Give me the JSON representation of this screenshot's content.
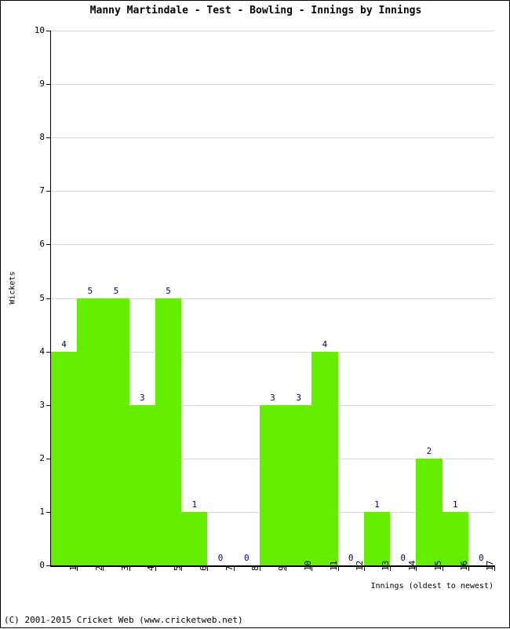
{
  "title": "Manny Martindale - Test - Bowling - Innings by Innings",
  "footer": "(C) 2001-2015 Cricket Web (www.cricketweb.net)",
  "colors": {
    "bar": "#66ee00",
    "label": "#000080",
    "axis": "#000000",
    "grid": "#d8d8d8",
    "background": "#ffffff"
  },
  "chart_data": {
    "type": "bar",
    "title": "Manny Martindale - Test - Bowling - Innings by Innings",
    "xlabel": "Innings (oldest to newest)",
    "ylabel": "Wickets",
    "categories": [
      "1",
      "2",
      "3",
      "4",
      "5",
      "6",
      "7",
      "8",
      "9",
      "10",
      "11",
      "12",
      "13",
      "14",
      "15",
      "16",
      "17"
    ],
    "values": [
      4,
      5,
      5,
      3,
      5,
      1,
      0,
      0,
      3,
      3,
      4,
      0,
      1,
      0,
      2,
      1,
      0
    ],
    "ylim": [
      0,
      10
    ],
    "yticks": [
      0,
      1,
      2,
      3,
      4,
      5,
      6,
      7,
      8,
      9,
      10
    ],
    "ytick_labels": [
      "0",
      "1",
      "2",
      "3",
      "4",
      "5",
      "6",
      "7",
      "8",
      "9",
      "10"
    ],
    "grid": true,
    "legend": false,
    "bar_labels": [
      "4",
      "5",
      "5",
      "3",
      "5",
      "1",
      "0",
      "0",
      "3",
      "3",
      "4",
      "0",
      "1",
      "0",
      "2",
      "1",
      "0"
    ]
  }
}
